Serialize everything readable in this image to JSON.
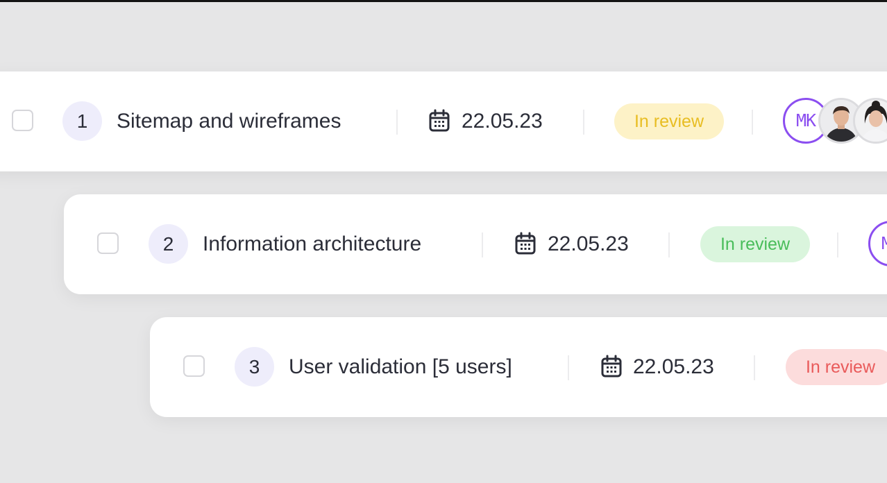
{
  "tasks": [
    {
      "number": "1",
      "title": "Sitemap and wireframes",
      "date": "22.05.23",
      "status": "In review",
      "status_color": "#e8bd22",
      "status_bg": "#fdf2c7",
      "assignee_initials": "MK"
    },
    {
      "number": "2",
      "title": "Information architecture",
      "date": "22.05.23",
      "status": "In review",
      "status_color": "#49bd5a",
      "status_bg": "#daf5dd",
      "assignee_initials": "MK"
    },
    {
      "number": "3",
      "title": "User validation [5 users]",
      "date": "22.05.23",
      "status": "In review",
      "status_color": "#e95a5a",
      "status_bg": "#fcdcdc"
    }
  ],
  "icons": {
    "checkbox": "checkbox-icon",
    "date": "calendar-icon",
    "avatar_photo": "user-photo"
  },
  "colors": {
    "accent_purple": "#8b4ef0",
    "number_badge_bg": "#eeedfb",
    "page_bg": "#e6e6e7"
  }
}
